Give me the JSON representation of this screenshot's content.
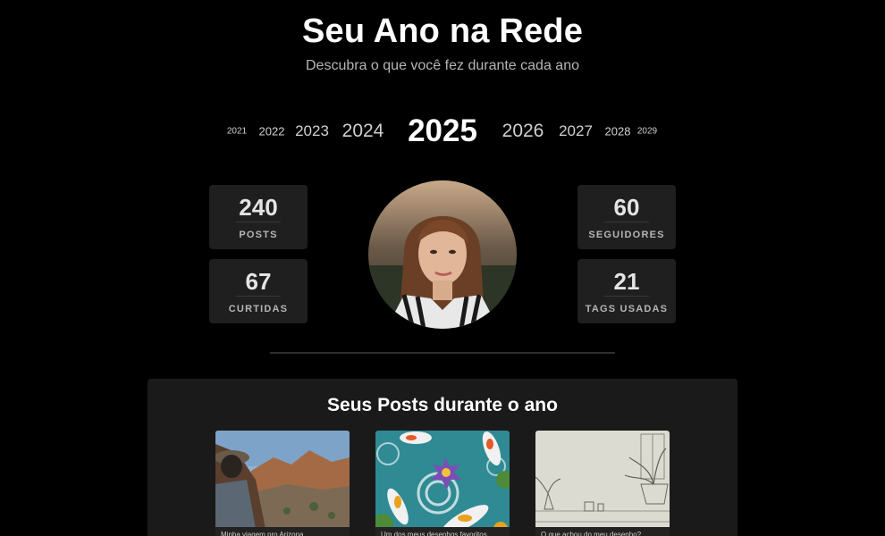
{
  "header": {
    "title": "Seu Ano na Rede",
    "subtitle": "Descubra o que você fez durante cada ano"
  },
  "years": [
    "2021",
    "2022",
    "2023",
    "2024",
    "2025",
    "2026",
    "2027",
    "2028",
    "2029"
  ],
  "selected_year": "2025",
  "stats": {
    "posts": {
      "value": "240",
      "label": "POSTS"
    },
    "curtidas": {
      "value": "67",
      "label": "CURTIDAS"
    },
    "seguidores": {
      "value": "60",
      "label": "SEGUIDORES"
    },
    "tags": {
      "value": "21",
      "label": "TAGS USADAS"
    }
  },
  "posts_section": {
    "title": "Seus Posts durante o ano",
    "posts": [
      {
        "caption": "Minha viagem pro Arizona"
      },
      {
        "caption": "Um dos meus desenhos favoritos"
      },
      {
        "caption": "O que achou do meu desenho?"
      }
    ]
  }
}
